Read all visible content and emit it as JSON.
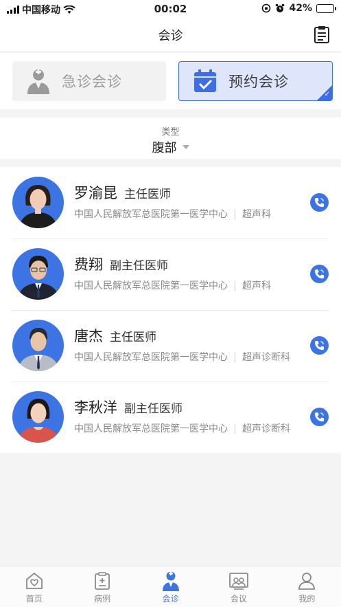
{
  "status_bar": {
    "carrier": "中国移动",
    "time": "00:02",
    "battery": "42%",
    "battery_level": 0.42
  },
  "nav": {
    "title": "会诊",
    "list_icon": "clipboard-list-icon"
  },
  "modes": {
    "emergency_label": "急诊会诊",
    "appointment_label": "预约会诊",
    "selected": "appointment",
    "accent": "#3d6ee6"
  },
  "filter": {
    "type_label": "类型",
    "type_value": "腹部"
  },
  "doctors": [
    {
      "name": "罗渝昆",
      "title": "主任医师",
      "hospital": "中国人民解放军总医院第一医学中心",
      "department": "超声科"
    },
    {
      "name": "费翔",
      "title": "副主任医师",
      "hospital": "中国人民解放军总医院第一医学中心",
      "department": "超声科"
    },
    {
      "name": "唐杰",
      "title": "主任医师",
      "hospital": "中国人民解放军总医院第一医学中心",
      "department": "超声诊断科"
    },
    {
      "name": "李秋洋",
      "title": "副主任医师",
      "hospital": "中国人民解放军总医院第一医学中心",
      "department": "超声诊断科"
    }
  ],
  "tabs": [
    {
      "label": "首页",
      "icon": "home-icon"
    },
    {
      "label": "病例",
      "icon": "medical-record-icon"
    },
    {
      "label": "会诊",
      "icon": "doctor-icon",
      "active": true
    },
    {
      "label": "会议",
      "icon": "meeting-icon"
    },
    {
      "label": "我的",
      "icon": "profile-icon"
    }
  ]
}
